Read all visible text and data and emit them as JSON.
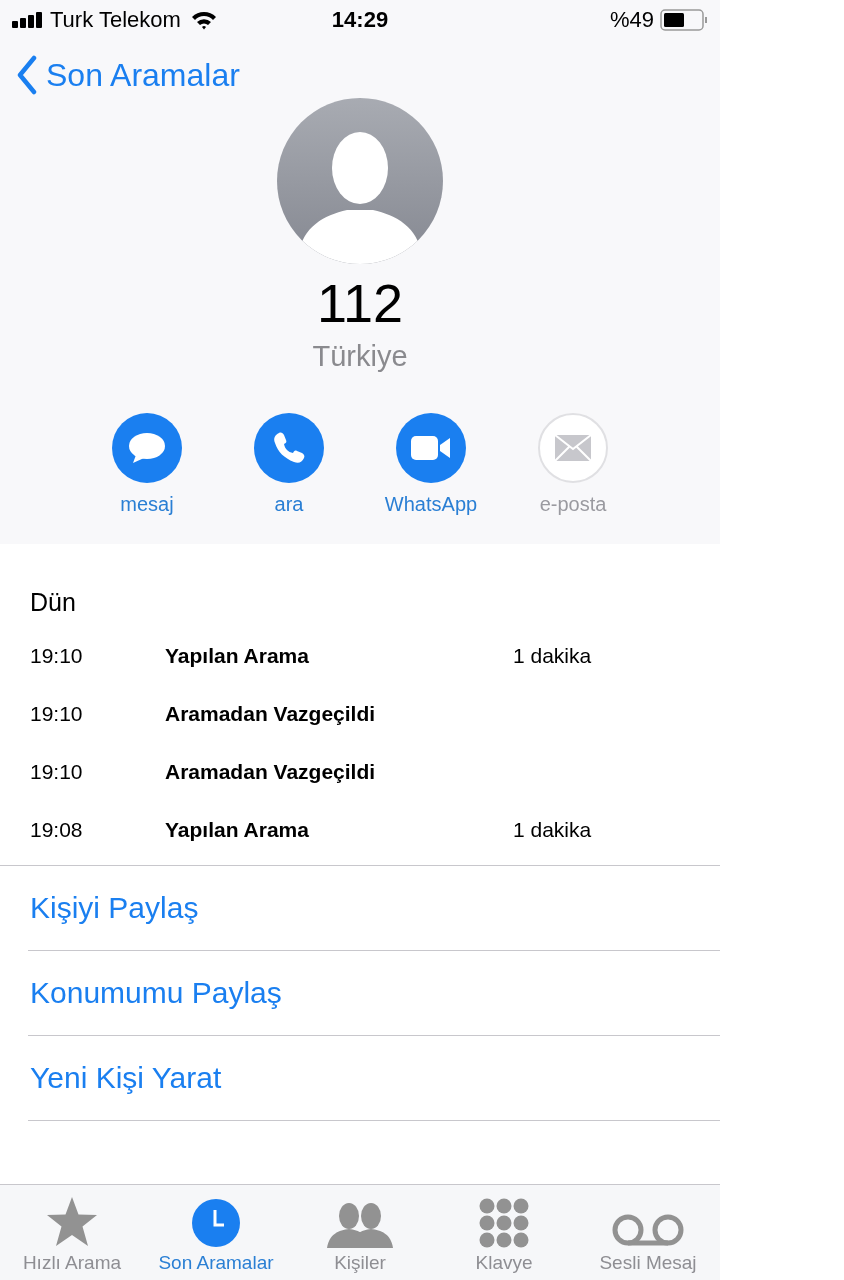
{
  "status_bar": {
    "carrier": "Turk Telekom",
    "time": "14:29",
    "battery": "%49"
  },
  "nav": {
    "back": "Son Aramalar"
  },
  "contact": {
    "number": "112",
    "country": "Türkiye"
  },
  "actions": [
    {
      "kind": "message",
      "label": "mesaj",
      "disabled": false
    },
    {
      "kind": "call",
      "label": "ara",
      "disabled": false
    },
    {
      "kind": "video",
      "label": "WhatsApp",
      "disabled": false
    },
    {
      "kind": "mail",
      "label": "e-posta",
      "disabled": true
    }
  ],
  "history": {
    "day": "Dün",
    "rows": [
      {
        "time": "19:10",
        "type": "Yapılan Arama",
        "duration": "1 dakika"
      },
      {
        "time": "19:10",
        "type": "Aramadan Vazgeçildi"
      },
      {
        "time": "19:10",
        "type": "Aramadan Vazgeçildi"
      },
      {
        "time": "19:08",
        "type": "Yapılan Arama",
        "duration": "1 dakika"
      }
    ]
  },
  "menu": [
    "Kişiyi Paylaş",
    "Konumumu Paylaş",
    "Yeni Kişi Yarat"
  ],
  "tabs": [
    {
      "kind": "favorites",
      "label": "Hızlı Arama",
      "selected": false
    },
    {
      "kind": "recents",
      "label": "Son Aramalar",
      "selected": true
    },
    {
      "kind": "contacts",
      "label": "Kişiler",
      "selected": false
    },
    {
      "kind": "keypad",
      "label": "Klavye",
      "selected": false
    },
    {
      "kind": "voicemail",
      "label": "Sesli Mesaj",
      "selected": false
    }
  ]
}
